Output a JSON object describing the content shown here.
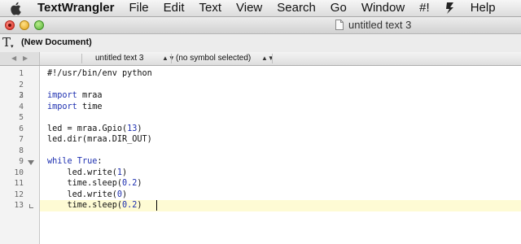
{
  "menubar": {
    "app_name": "TextWrangler",
    "items": [
      "File",
      "Edit",
      "Text",
      "View",
      "Search",
      "Go",
      "Window",
      "#!"
    ],
    "help": "Help"
  },
  "window": {
    "title": "untitled text 3"
  },
  "toolbar": {
    "document_label": "(New Document)"
  },
  "navbar": {
    "document_popup": "untitled text 3",
    "symbol_popup": "(no symbol selected)"
  },
  "editor": {
    "line_numbers": [
      "1",
      "2",
      "3",
      "4",
      "5",
      "6",
      "7",
      "8",
      "9",
      "10",
      "11",
      "12",
      "13"
    ],
    "current_line": 13,
    "code": {
      "shebang": "#!/usr/bin/env python",
      "import1_kw": "import",
      "import1_mod": " mraa",
      "import2_kw": "import",
      "import2_mod": " time",
      "led_prefix": "led = mraa.Gpio(",
      "led_num": "13",
      "led_suffix": ")",
      "dir_line": "led.dir(mraa.DIR_OUT)",
      "while_kw": "while",
      "true_kw": " True",
      "while_colon": ":",
      "w1_prefix": "    led.write(",
      "w1_num": "1",
      "w1_suffix": ")",
      "s1_prefix": "    time.sleep(",
      "s1_num": "0.2",
      "s1_suffix": ")",
      "w0_prefix": "    led.write(",
      "w0_num": "0",
      "w0_suffix": ")",
      "s2_prefix": "    time.sleep(",
      "s2_num": "0.2",
      "s2_suffix": ")"
    }
  },
  "colors": {
    "keyword": "#1d2fb0",
    "current_line_highlight": "#fefbd4"
  }
}
